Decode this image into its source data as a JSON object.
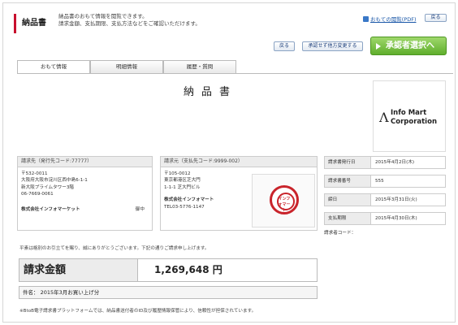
{
  "header": {
    "title": "納品書",
    "description": [
      "納品書のおもて情報を閲覧できます。",
      "請求金額、支払期限、支払方法などをご確認いただけます。"
    ],
    "help_link": "おもての閲覧(PDF)",
    "back_label": "戻る"
  },
  "actions": {
    "back": "戻る",
    "unapproved_change": "承認せず他方変更する",
    "approve_select": "承認者選択へ"
  },
  "tabs": [
    {
      "label": "おもて情報",
      "active": true
    },
    {
      "label": "明細情報",
      "active": false
    },
    {
      "label": "履歴・質問",
      "active": false
    }
  ],
  "document": {
    "title": "納品書",
    "logo": {
      "mark": "Λ",
      "line1": "Info Mart",
      "line2": "Corporation"
    },
    "billing_to": {
      "header": "請求先（発行先コード:77777）",
      "lines": [
        "〒532-0011",
        "大阪府大阪市淀川区西中島6-1-1",
        "新大阪プライムタワー3階",
        "06-7669-0061"
      ],
      "company": "株式会社インフォマーケット",
      "honorific": "御中"
    },
    "billing_from": {
      "header": "請求元（支払先コード:9999-002）",
      "lines": [
        "〒105-0012",
        "東京都港区芝大門",
        "1-1-1 芝大門ビル"
      ],
      "company": "株式会社インフォマート",
      "tel": "TEL03-5776-1147"
    },
    "stamp_text": "インフォマート",
    "info": [
      {
        "label": "請求書発行日",
        "value": "2015年4月2日(木)"
      },
      {
        "label": "請求書番号",
        "value": "555"
      },
      {
        "label": "締日",
        "value": "2015年3月31日(火)"
      },
      {
        "label": "支払期限",
        "value": "2015年4月30日(木)"
      }
    ],
    "requester_code_label": "請求者コード：",
    "greeting": "平素は格別のお引立てを賜り、誠にありがとうございます。下記の通りご請求申し上げます。",
    "total_label": "請求金額",
    "total_value": "1,269,648 円",
    "subject_label": "件名：",
    "subject_value": "2015年3月お買い上げ分",
    "footer_note": "※BtoB電子請求書プラットフォームでは、納品書送付者のID及び履歴情報保管により、信頼性が担保されています。"
  },
  "colors": {
    "accent": "#c8102e",
    "approve": "#5fae2c",
    "link": "#1a57a8"
  }
}
